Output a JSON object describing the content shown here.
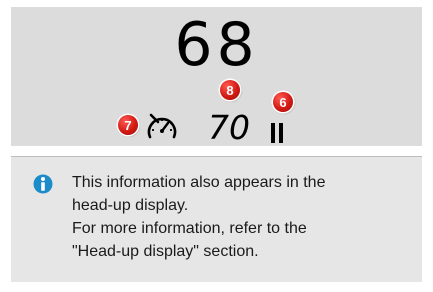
{
  "display": {
    "current_speed": "68",
    "set_speed": "70"
  },
  "callouts": {
    "limiter": "7",
    "set_speed": "8",
    "status": "6"
  },
  "icons": {
    "limiter": "speed-limiter-icon",
    "status": "pause-icon",
    "info": "info-icon"
  },
  "colors": {
    "badge_red": "#d31a14",
    "info_blue": "#1c8bc9",
    "panel_gray": "#dcdcdc"
  },
  "info": {
    "lines": [
      "This information also appears in the",
      "head-up display.",
      "For more information, refer to the",
      "\"Head-up display\" section."
    ]
  }
}
